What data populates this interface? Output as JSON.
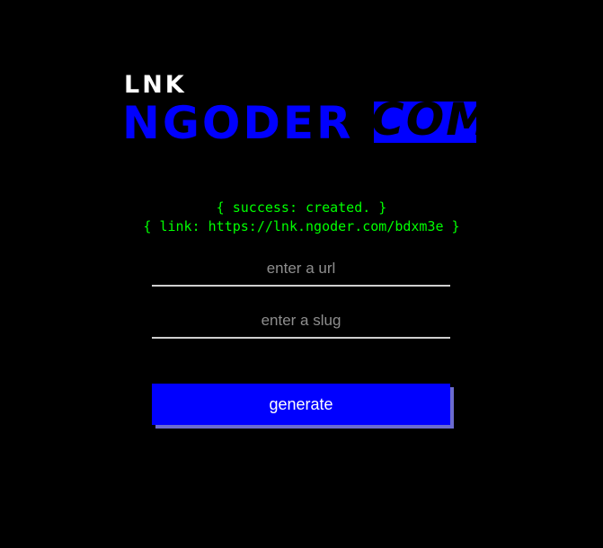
{
  "logo": {
    "top_text": "LNK",
    "main_text": "NGODER",
    "suffix_text": "COM"
  },
  "status": {
    "success_line": "{ success: created. }",
    "link_line": "{ link: https://lnk.ngoder.com/bdxm3e }"
  },
  "form": {
    "url_placeholder": "enter a url",
    "url_value": "",
    "slug_placeholder": "enter a slug",
    "slug_value": "",
    "submit_label": "generate"
  },
  "colors": {
    "background": "#000000",
    "brand_blue": "#0000ff",
    "success_green": "#00ff00",
    "button_shadow": "#6b6bd0"
  }
}
